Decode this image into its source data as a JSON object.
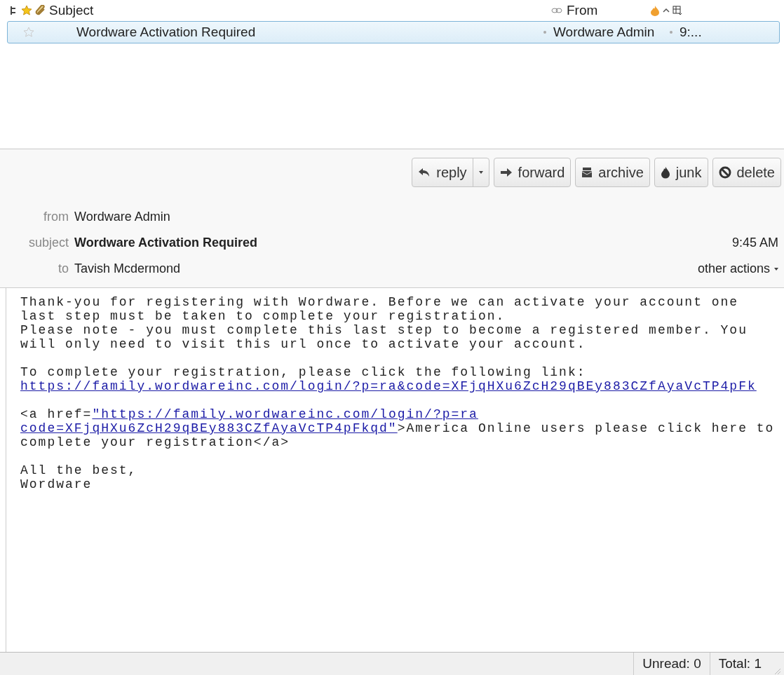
{
  "message_list": {
    "columns": [
      {
        "kind": "thread"
      },
      {
        "kind": "star"
      },
      {
        "kind": "attachment"
      },
      {
        "kind": "subject",
        "label": "Subject"
      },
      {
        "kind": "link"
      },
      {
        "kind": "from",
        "label": "From"
      },
      {
        "kind": "junk"
      },
      {
        "kind": "sort"
      },
      {
        "kind": "picker"
      }
    ],
    "rows": [
      {
        "selected": true,
        "starred": false,
        "subject": "Wordware Activation Required",
        "from": "Wordware Admin",
        "date": "9:..."
      }
    ]
  },
  "toolbar": [
    {
      "kind": "reply",
      "label": "reply",
      "dropdown": true
    },
    {
      "kind": "forward",
      "label": "forward",
      "dropdown": false
    },
    {
      "kind": "archive",
      "label": "archive",
      "dropdown": false
    },
    {
      "kind": "junk",
      "label": "junk",
      "dropdown": false
    },
    {
      "kind": "delete",
      "label": "delete",
      "dropdown": false
    }
  ],
  "header": {
    "fields": [
      {
        "label": "from",
        "value": "Wordware Admin",
        "bold": false
      },
      {
        "label": "subject",
        "value": "Wordware Activation Required",
        "bold": true
      },
      {
        "label": "to",
        "value": "Tavish Mcdermond",
        "bold": false
      }
    ],
    "date": "9:45 AM",
    "other_actions": "other actions"
  },
  "body": [
    [
      [
        {
          "kind": "text",
          "text": "Thank-you for registering with Wordware. Before we can activate your account one"
        }
      ],
      [
        {
          "kind": "text",
          "text": "last step must be taken to complete your registration."
        }
      ],
      [
        {
          "kind": "text",
          "text": "Please note - you must complete this last step to become a registered member. You"
        }
      ],
      [
        {
          "kind": "text",
          "text": "will only need to visit this url once to activate your account."
        }
      ]
    ],
    [
      [
        {
          "kind": "text",
          "text": "To complete your registration, please click the following link:"
        }
      ],
      [
        {
          "kind": "link",
          "text": "https://family.wordwareinc.com/login/?p=ra&code=XFjqHXu6ZcH29qBEy883CZfAyaVcTP4pFk"
        }
      ]
    ],
    [
      [
        {
          "kind": "text",
          "text": "<a href="
        },
        {
          "kind": "link",
          "text": "\"https://family.wordwareinc.com/login/?p=ra"
        }
      ],
      [
        {
          "kind": "link",
          "text": "code=XFjqHXu6ZcH29qBEy883CZfAyaVcTP4pFkqd\""
        },
        {
          "kind": "text",
          "text": ">America Online users please click here to"
        }
      ],
      [
        {
          "kind": "text",
          "text": "complete your registration</a>"
        }
      ]
    ],
    [
      [
        {
          "kind": "text",
          "text": "All the best,"
        }
      ],
      [
        {
          "kind": "text",
          "text": "Wordware"
        }
      ]
    ]
  ],
  "status_bar": {
    "unread": "Unread: 0",
    "total": "Total: 1"
  }
}
